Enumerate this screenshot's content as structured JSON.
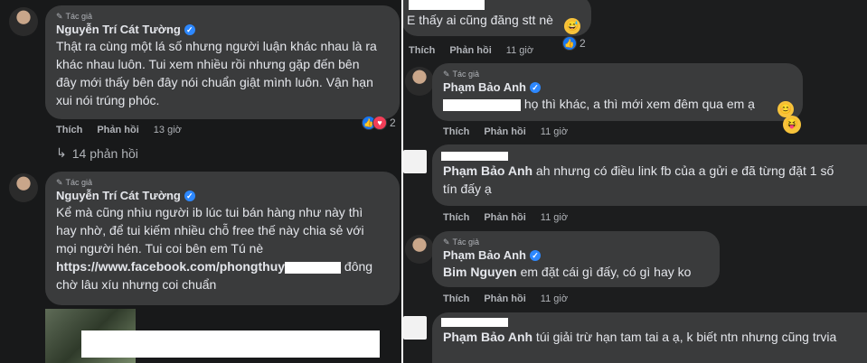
{
  "left": {
    "comment1": {
      "author_tag": "Tác giả",
      "name": "Nguyễn Trí Cát Tường",
      "line1": "Thật ra cùng một lá số nhưng người luận khác nhau là ra",
      "line2": "khác nhau luôn. Tui xem nhiều rồi nhưng gặp đến bên",
      "line3": "đây mới thấy bên đây nói chuẩn giật mình luôn. Vận hạn",
      "line4": "xui nói trúng phóc.",
      "like": "Thích",
      "reply": "Phản hồi",
      "time": "13 giờ",
      "reaction_count": "2",
      "replies_link": "14 phản hồi"
    },
    "comment2": {
      "author_tag": "Tác giả",
      "name": "Nguyễn Trí Cát Tường",
      "line1": "Kể mà cũng nhìu người ib lúc tui bán hàng như này thì",
      "line2": "hay nhờ, để tui kiếm nhiều chỗ free thế này chia sẻ với",
      "line3": "mọi người hén. Tui coi bên em Tú nè",
      "link_prefix": "https://www.facebook.com/phongthuy",
      "link_suffix": " đông",
      "line5": "chờ lâu xíu nhưng coi chuẩn"
    }
  },
  "right": {
    "top_comment": {
      "text": "E thấy ai cũng đăng stt nè",
      "like": "Thích",
      "reply": "Phản hồi",
      "time": "11 giờ",
      "reaction_count": "2"
    },
    "reply1": {
      "author_tag": "Tác giả",
      "name": "Phạm Bảo Anh",
      "text": "họ thì khác, a thì mới xem đêm qua em ạ",
      "like": "Thích",
      "reply": "Phản hồi",
      "time": "11 giờ"
    },
    "reply2": {
      "mention": "Phạm Bảo Anh",
      "text": " ah nhưng có điều link fb của a gửi e đã từng đặt 1 số",
      "line2": "tín đấy ạ",
      "like": "Thích",
      "reply": "Phản hồi",
      "time": "11 giờ"
    },
    "reply3": {
      "author_tag": "Tác giả",
      "name": "Phạm Bảo Anh",
      "mention": "Bim Nguyen",
      "text": " em đặt cái gì đấy, có gì hay ko",
      "like": "Thích",
      "reply": "Phản hồi",
      "time": "11 giờ"
    },
    "reply4": {
      "mention": "Phạm Bảo Anh",
      "text": " túi giải trừ hạn tam tai a ạ, k biết ntn nhưng cũng trvia"
    }
  },
  "colors": {
    "background": "#18191a",
    "bubble": "#3a3b3c",
    "text": "#e4e6eb",
    "muted": "#b0b3b8",
    "verified": "#2d88ff",
    "like": "#1877f2",
    "love": "#f33e58"
  }
}
